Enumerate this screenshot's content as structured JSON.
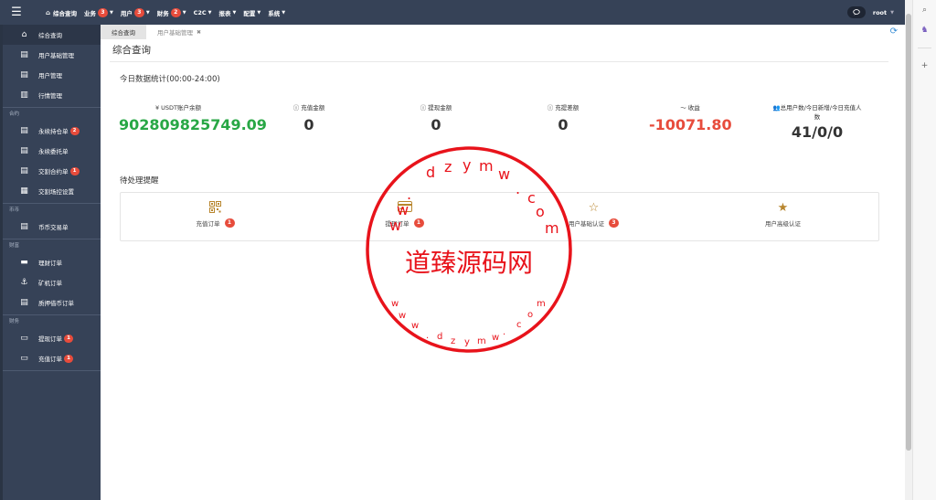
{
  "topnav": {
    "menu_icon": "hamburger-icon",
    "items": [
      {
        "label": "综合查询",
        "icon": "home-icon",
        "badge": "",
        "caret": false
      },
      {
        "label": "业务",
        "badge": "3",
        "caret": true
      },
      {
        "label": "用户",
        "badge": "3",
        "caret": true
      },
      {
        "label": "财务",
        "badge": "2",
        "caret": true
      },
      {
        "label": "C2C",
        "badge": "",
        "caret": true
      },
      {
        "label": "报表",
        "badge": "",
        "caret": true
      },
      {
        "label": "配置",
        "badge": "",
        "caret": true
      },
      {
        "label": "系统",
        "badge": "",
        "caret": true
      }
    ],
    "user": "root"
  },
  "sidebar": {
    "top": [
      {
        "label": "综合查询",
        "icon": "home-icon",
        "active": true
      },
      {
        "label": "用户基础管理",
        "icon": "document-icon"
      },
      {
        "label": "用户管理",
        "icon": "document-icon"
      },
      {
        "label": "行情管理",
        "icon": "bar-chart-icon"
      }
    ],
    "groups": [
      {
        "title": "合约",
        "items": [
          {
            "label": "永续持仓单",
            "icon": "document-icon",
            "badge": "2"
          },
          {
            "label": "永续委托单",
            "icon": "document-icon"
          },
          {
            "label": "交割合约单",
            "icon": "document-icon",
            "badge": "1"
          },
          {
            "label": "交割场控设置",
            "icon": "columns-icon"
          }
        ]
      },
      {
        "title": "币币",
        "items": [
          {
            "label": "币币交易单",
            "icon": "document-icon"
          }
        ]
      },
      {
        "title": "财富",
        "items": [
          {
            "label": "理财订单",
            "icon": "folder-icon"
          },
          {
            "label": "矿机订单",
            "icon": "anchor-icon"
          },
          {
            "label": "质押借币订单",
            "icon": "document-icon"
          }
        ]
      },
      {
        "title": "财务",
        "items": [
          {
            "label": "提现订单",
            "icon": "credit-card-icon",
            "badge": "1"
          },
          {
            "label": "充值订单",
            "icon": "credit-card-icon",
            "badge": "1"
          }
        ]
      }
    ]
  },
  "tabs": [
    {
      "label": "综合查询",
      "active": true
    },
    {
      "label": "用户基础管理",
      "active": false,
      "closable": true
    }
  ],
  "page_title": "综合查询",
  "stats": {
    "title": "今日数据统计(00:00-24:00)",
    "items": [
      {
        "label": "USDT账户余额",
        "value": "902809825749.09",
        "color": "#28a745",
        "icon": "yen-icon"
      },
      {
        "label": "充值金额",
        "value": "0",
        "color": "#333333",
        "icon": "info-circle-icon"
      },
      {
        "label": "提现金额",
        "value": "0",
        "color": "#333333",
        "icon": "info-circle-icon"
      },
      {
        "label": "充提差额",
        "value": "0",
        "color": "#333333",
        "icon": "info-circle-icon"
      },
      {
        "label": "收益",
        "value": "-10071.80",
        "color": "#e74c3c",
        "icon": "line-chart-icon"
      },
      {
        "label": "总用户数/今日新增/今日充值人",
        "label2": "数",
        "value": "41/0/0",
        "color": "#333333",
        "icon": "users-icon"
      }
    ]
  },
  "pending": {
    "title": "待处理提醒",
    "items": [
      {
        "label": "充值订单",
        "badge": "1",
        "icon": "qrcode-icon"
      },
      {
        "label": "提现订单",
        "badge": "1",
        "icon": "credit-card-icon"
      },
      {
        "label": "用户基础认证",
        "badge": "3",
        "icon": "star-outline-icon"
      },
      {
        "label": "用户高级认证",
        "badge": "",
        "icon": "star-filled-icon"
      }
    ]
  },
  "stamp": {
    "text": "道臻源码网",
    "url": "www.dzym.com"
  },
  "right_panel": {
    "icons": [
      "search-icon",
      "extension-icon",
      "plus-icon"
    ]
  }
}
